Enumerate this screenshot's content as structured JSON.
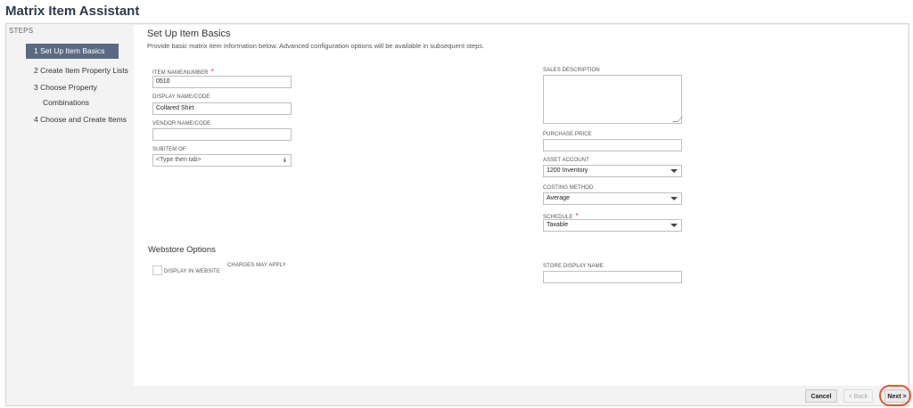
{
  "app": {
    "title": "Matrix Item Assistant"
  },
  "steps": {
    "header": "STEPS",
    "items": [
      {
        "label": "1 Set Up Item Basics",
        "active": true
      },
      {
        "label": "2 Create Item Property Lists",
        "active": false
      },
      {
        "label": "3 Choose Property",
        "active": false
      },
      {
        "label": "Combinations",
        "active": false
      },
      {
        "label": "4 Choose and Create Items",
        "active": false
      }
    ]
  },
  "page": {
    "title": "Set Up Item Basics",
    "description": "Provide basic matrix item information below. Advanced configuration options will be available in subsequent steps."
  },
  "fields": {
    "item_name": {
      "label": "ITEM NAME/NUMBER",
      "required_mark": "*",
      "value": "0510"
    },
    "display_name": {
      "label": "DISPLAY NAME/CODE",
      "value": "Collared Shirt"
    },
    "vendor_name": {
      "label": "VENDOR NAME/CODE",
      "value": ""
    },
    "subitem_of": {
      "label": "SUBITEM OF",
      "placeholder": "<Type then tab>",
      "icon": "double-chevron-down-icon"
    },
    "sales_description": {
      "label": "SALES DESCRIPTION",
      "value": ""
    },
    "purchase_price": {
      "label": "PURCHASE PRICE",
      "value": ""
    },
    "asset_account": {
      "label": "ASSET ACCOUNT",
      "value": "1200 Inventory"
    },
    "costing_method": {
      "label": "COSTING METHOD",
      "value": "Average"
    },
    "schedule": {
      "label": "SCHEDULE",
      "required_mark": "*",
      "value": "Taxable"
    }
  },
  "webstore": {
    "title": "Webstore Options",
    "display_in_website": {
      "label": "DISPLAY IN WEBSITE",
      "checked": false
    },
    "charges_note": "CHARGES MAY APPLY",
    "store_display_name": {
      "label": "STORE DISPLAY NAME",
      "value": ""
    }
  },
  "footer": {
    "cancel": "Cancel",
    "back": "< Back",
    "next": "Next >"
  },
  "colors": {
    "active_step_bg": "#5a6a83",
    "title": "#2b3a4e",
    "required": "#d33333",
    "highlight": "#e05a2b"
  }
}
